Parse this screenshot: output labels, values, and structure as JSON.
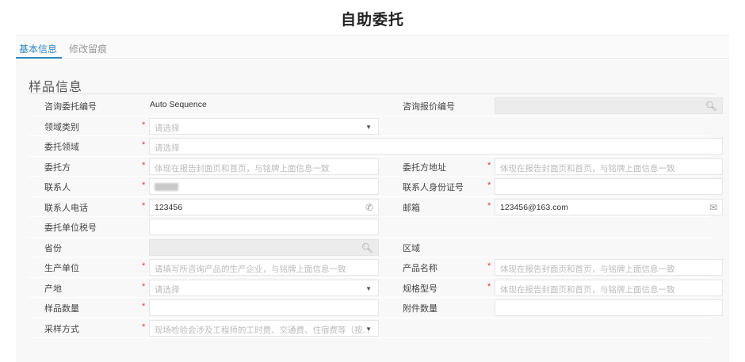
{
  "page_title": "自助委托",
  "tabs": [
    {
      "label": "基本信息",
      "active": true
    },
    {
      "label": "修改留痕",
      "active": false
    }
  ],
  "section_title": "样品信息",
  "fields": {
    "consult_no": {
      "label": "咨询委托编号",
      "value": "Auto Sequence"
    },
    "quote_no": {
      "label": "咨询报价编号"
    },
    "domain_category": {
      "label": "领域类别",
      "placeholder": "请选择"
    },
    "commission_domain": {
      "label": "委托领域",
      "placeholder": "请选择"
    },
    "client": {
      "label": "委托方",
      "placeholder": "体现在报告封面页和首页，与铭牌上面信息一致"
    },
    "client_address": {
      "label": "委托方地址",
      "placeholder": "体现在报告封面页和首页，与铭牌上面信息一致"
    },
    "contact": {
      "label": "联系人"
    },
    "contact_id": {
      "label": "联系人身份证号"
    },
    "contact_phone": {
      "label": "联系人电话",
      "value": "123456"
    },
    "email": {
      "label": "邮箱",
      "value": "123456@163.com"
    },
    "tax_no": {
      "label": "委托单位税号"
    },
    "province": {
      "label": "省份"
    },
    "region": {
      "label": "区域"
    },
    "manufacturer": {
      "label": "生产单位",
      "placeholder": "请填写所咨询产品的生产企业，与铭牌上面信息一致"
    },
    "product_name": {
      "label": "产品名称",
      "placeholder": "体现在报告封面页和首页，与铭牌上面信息一致"
    },
    "origin": {
      "label": "产地",
      "placeholder": "请选择"
    },
    "model_spec": {
      "label": "规格型号",
      "placeholder": "体现在报告封面页和首页，与铭牌上面信息一致"
    },
    "sample_qty": {
      "label": "样品数量"
    },
    "attachment_qty": {
      "label": "附件数量"
    },
    "sampling_method": {
      "label": "采样方式",
      "placeholder": "现场检验会涉及工程师的工时费、交通费、住宿费等（按..."
    }
  },
  "required_mark": "*",
  "icons": {
    "search": "search-icon",
    "phone": "phone-icon",
    "mail": "mail-icon",
    "dropdown": "chevron-down-icon"
  },
  "colors": {
    "accent": "#2e86c1",
    "required": "#e03a3a"
  }
}
